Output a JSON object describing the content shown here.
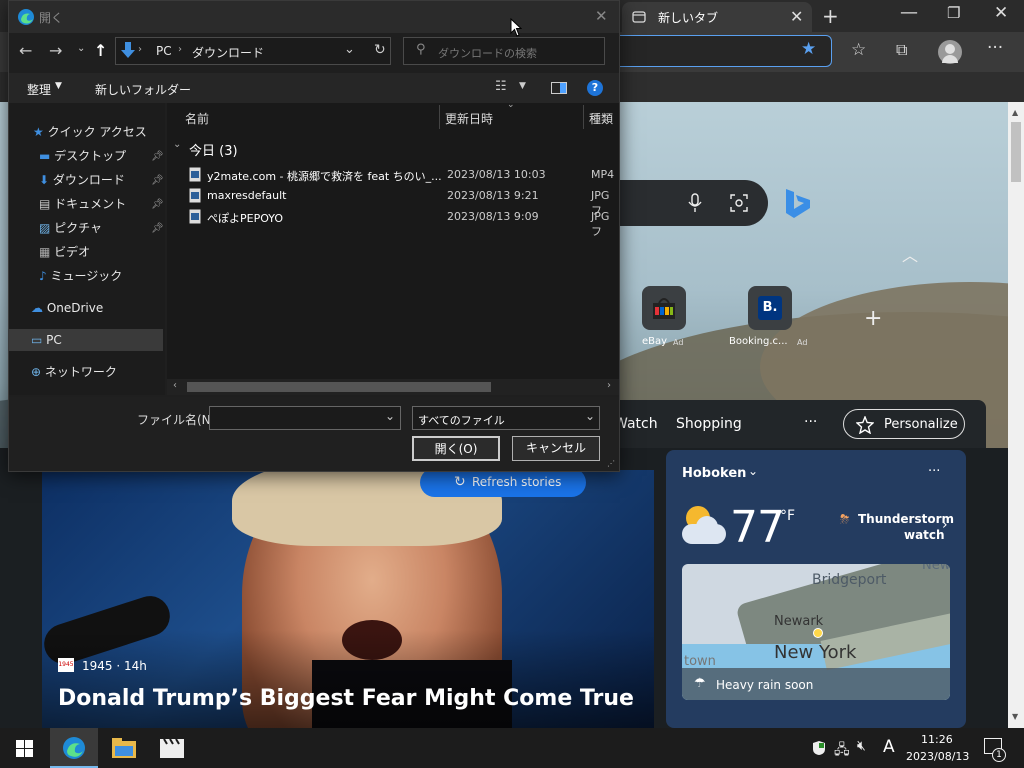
{
  "edge": {
    "tab_title": "新しいタブ",
    "nav_items": [
      "Watch",
      "Shopping"
    ],
    "more": "···",
    "personalize": "Personalize",
    "quicklinks": [
      {
        "label": "eBay",
        "ad": "Ad"
      },
      {
        "label": "Booking.c...",
        "ad": "Ad"
      }
    ],
    "refresh": "Refresh stories",
    "story": {
      "source_badge": "1945",
      "source": "1945 · 14h",
      "headline": "Donald Trump’s Biggest Fear Might Come True"
    },
    "weather": {
      "location": "Hoboken",
      "temp": "77",
      "unit": "°F",
      "alert_line1": "Thunderstorm",
      "alert_line2": "watch",
      "map_labels": [
        "Bridgeport",
        "Newark",
        "New York",
        "town",
        "New"
      ],
      "rain_note": "Heavy rain soon"
    }
  },
  "dialog": {
    "title": "開く",
    "path": [
      "PC",
      "ダウンロード"
    ],
    "search_placeholder": "ダウンロードの検索",
    "organize": "整理",
    "new_folder": "新しいフォルダー",
    "columns": {
      "name": "名前",
      "date": "更新日時",
      "type": "種類"
    },
    "group": "今日 (3)",
    "files": [
      {
        "name": "y2mate.com - 桃源郷で救済を feat ちのい_...",
        "date": "2023/08/13 10:03",
        "type": "MP4"
      },
      {
        "name": "maxresdefault",
        "date": "2023/08/13 9:21",
        "type": "JPG フ"
      },
      {
        "name": "ぺぽよPEPOYO",
        "date": "2023/08/13 9:09",
        "type": "JPG フ"
      }
    ],
    "tree": [
      {
        "label": "クイック アクセス",
        "icon": "star-icon"
      },
      {
        "label": "デスクトップ",
        "icon": "desktop-icon",
        "pin": true
      },
      {
        "label": "ダウンロード",
        "icon": "download-icon",
        "pin": true
      },
      {
        "label": "ドキュメント",
        "icon": "document-icon",
        "pin": true
      },
      {
        "label": "ピクチャ",
        "icon": "picture-icon",
        "pin": true
      },
      {
        "label": "ビデオ",
        "icon": "video-icon"
      },
      {
        "label": "ミュージック",
        "icon": "music-icon"
      },
      {
        "label": "OneDrive",
        "icon": "cloud-icon"
      },
      {
        "label": "PC",
        "icon": "pc-icon"
      },
      {
        "label": "ネットワーク",
        "icon": "network-icon"
      }
    ],
    "filename_label": "ファイル名(N):",
    "filename_value": "",
    "filter": "すべてのファイル",
    "open_btn": "開く(O)",
    "cancel_btn": "キャンセル"
  },
  "taskbar": {
    "time": "11:26",
    "date": "2023/08/13",
    "ime": "A",
    "notification_count": "1"
  }
}
